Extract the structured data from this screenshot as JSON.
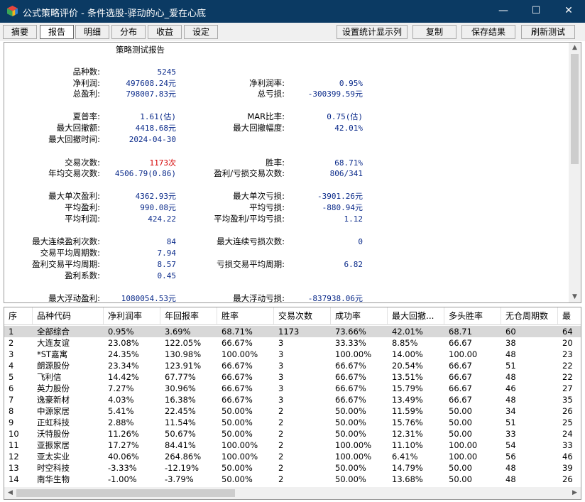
{
  "window": {
    "title": "公式策略评价 - 条件选股-驿动的心_爱在心底",
    "controls": {
      "minimize": "—",
      "maximize": "☐",
      "close": "✕"
    }
  },
  "toolbar": {
    "tabs": [
      "摘要",
      "报告",
      "明细",
      "分布",
      "收益",
      "设定"
    ],
    "active_tab": "报告",
    "actions": [
      "设置统计显示列",
      "复制",
      "保存结果",
      "刷新测试"
    ]
  },
  "report": {
    "title": "策略测试报告",
    "stats": {
      "count_label": "品种数:",
      "count": "5245",
      "net_profit_label": "净利润:",
      "net_profit": "497608.24元",
      "net_profit_rate_label": "净利润率:",
      "net_profit_rate": "0.95%",
      "gross_profit_label": "总盈利:",
      "gross_profit": "798007.83元",
      "gross_loss_label": "总亏损:",
      "gross_loss": "-300399.59元",
      "sharpe_label": "夏普率:",
      "sharpe": "1.61(估)",
      "mar_label": "MAR比率:",
      "mar": "0.75(估)",
      "max_dd_label": "最大回撤额:",
      "max_dd": "4418.68元",
      "max_dd_pct_label": "最大回撤幅度:",
      "max_dd_pct": "42.01%",
      "max_dd_time_label": "最大回撤时间:",
      "max_dd_time": "2024-04-30",
      "trades_label": "交易次数:",
      "trades": "1173次",
      "win_rate_label": "胜率:",
      "win_rate": "68.71%",
      "annual_trades_label": "年均交易次数:",
      "annual_trades": "4506.79(0.86)",
      "win_loss_trades_label": "盈利/亏损交易次数:",
      "win_loss_trades": "806/341",
      "max_single_win_label": "最大单次盈利:",
      "max_single_win": "4362.93元",
      "max_single_loss_label": "最大单次亏损:",
      "max_single_loss": "-3901.26元",
      "avg_win_label": "平均盈利:",
      "avg_win": "990.08元",
      "avg_loss_label": "平均亏损:",
      "avg_loss": "-880.94元",
      "avg_profit_label": "平均利润:",
      "avg_profit": "424.22",
      "avg_wl_ratio_label": "平均盈利/平均亏损:",
      "avg_wl_ratio": "1.12",
      "max_consec_win_label": "最大连续盈利次数:",
      "max_consec_win": "84",
      "max_consec_loss_label": "最大连续亏损次数:",
      "max_consec_loss": "0",
      "avg_period_label": "交易平均周期数:",
      "avg_period": "7.94",
      "win_avg_period_label": "盈利交易平均周期:",
      "win_avg_period": "8.57",
      "loss_avg_period_label": "亏损交易平均周期:",
      "loss_avg_period": "6.82",
      "profit_factor_label": "盈利系数:",
      "profit_factor": "0.45",
      "max_float_win_label": "最大浮动盈利:",
      "max_float_win": "1080054.53元",
      "max_float_loss_label": "最大浮动亏损:",
      "max_float_loss": "-837938.06元"
    }
  },
  "table": {
    "columns": [
      "序",
      "品种代码",
      "净利润率",
      "年回报率",
      "胜率",
      "交易次数",
      "成功率",
      "最大回撤...",
      "多头胜率",
      "无仓周期数",
      "最"
    ],
    "rows": [
      [
        "1",
        "全部综合",
        "0.95%",
        "3.69%",
        "68.71%",
        "1173",
        "73.66%",
        "42.01%",
        "68.71",
        "60",
        "64"
      ],
      [
        "2",
        "大连友谊",
        "23.08%",
        "122.05%",
        "66.67%",
        "3",
        "33.33%",
        "8.85%",
        "66.67",
        "38",
        "20"
      ],
      [
        "3",
        "*ST嘉寓",
        "24.35%",
        "130.98%",
        "100.00%",
        "3",
        "100.00%",
        "14.00%",
        "100.00",
        "48",
        "23"
      ],
      [
        "4",
        "朗源股份",
        "23.34%",
        "123.91%",
        "66.67%",
        "3",
        "66.67%",
        "20.54%",
        "66.67",
        "51",
        "22"
      ],
      [
        "5",
        "飞利信",
        "14.42%",
        "67.77%",
        "66.67%",
        "3",
        "66.67%",
        "13.51%",
        "66.67",
        "48",
        "22"
      ],
      [
        "6",
        "英力股份",
        "7.27%",
        "30.96%",
        "66.67%",
        "3",
        "66.67%",
        "15.79%",
        "66.67",
        "46",
        "27"
      ],
      [
        "7",
        "逸豪新材",
        "4.03%",
        "16.38%",
        "66.67%",
        "3",
        "66.67%",
        "13.49%",
        "66.67",
        "48",
        "35"
      ],
      [
        "8",
        "中源家居",
        "5.41%",
        "22.45%",
        "50.00%",
        "2",
        "50.00%",
        "11.59%",
        "50.00",
        "34",
        "26"
      ],
      [
        "9",
        "正虹科技",
        "2.88%",
        "11.54%",
        "50.00%",
        "2",
        "50.00%",
        "15.76%",
        "50.00",
        "51",
        "25"
      ],
      [
        "10",
        "沃特股份",
        "11.26%",
        "50.67%",
        "50.00%",
        "2",
        "50.00%",
        "12.31%",
        "50.00",
        "33",
        "24"
      ],
      [
        "11",
        "亚振家居",
        "17.27%",
        "84.41%",
        "100.00%",
        "2",
        "100.00%",
        "11.10%",
        "100.00",
        "54",
        "33"
      ],
      [
        "12",
        "亚太实业",
        "40.06%",
        "264.86%",
        "100.00%",
        "2",
        "100.00%",
        "6.41%",
        "100.00",
        "56",
        "46"
      ],
      [
        "13",
        "时空科技",
        "-3.33%",
        "-12.19%",
        "50.00%",
        "2",
        "50.00%",
        "14.79%",
        "50.00",
        "48",
        "39"
      ],
      [
        "14",
        "南华生物",
        "-1.00%",
        "-3.79%",
        "50.00%",
        "2",
        "50.00%",
        "13.68%",
        "50.00",
        "48",
        "26"
      ]
    ],
    "selected_row": 0
  },
  "icons": {
    "app": "cube-app-icon",
    "scroll_up": "▲",
    "scroll_down": "▼",
    "scroll_left": "◀",
    "scroll_right": "▶"
  },
  "colors": {
    "titlebar": "#0b3a63",
    "value_text": "#0a2a8a",
    "highlight_red": "#d40000",
    "selected_row": "#d8d8d8"
  }
}
